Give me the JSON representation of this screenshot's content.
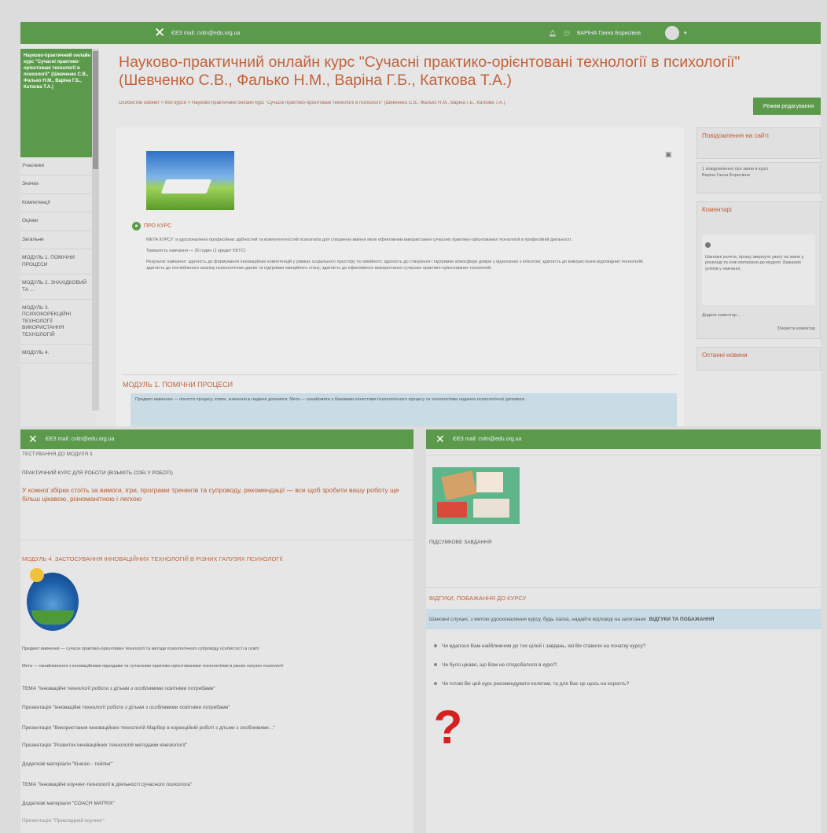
{
  "top": {
    "bar": {
      "email": "ЄЕЗ mail: cvitn@edu.org.ua",
      "user": "ВАРІНА Ганна Борисівна"
    },
    "sidebar": {
      "header": "Науково-практичний онлайн курс \"Сучасні практико-орієнтовані технології в психології\" (Шевченко С.В., Фалько Н.М., Варіна Г.Б., Каткова Т.А.)",
      "items": [
        "Учасники",
        "Значки",
        "Компетенції",
        "Оцінки",
        "Загальне",
        "МОДУЛЬ 1. ПОМІЧНИ ПРОЦЕСИ",
        "МОДУЛЬ 2. ЗНАХІДКОВИЙ ТА ...",
        "МОДУЛЬ 3. ПСИХОКОРЕКЦІЙНІ ТЕХНОЛОГІЇ ВИКОРИСТАННЯ ТЕХНОЛОГІЙ",
        "МОДУЛЬ 4."
      ]
    },
    "title": "Науково-практичний онлайн курс \"Сучасні практико-орієнтовані технології в психології\" (Шевченко С.В., Фалько Н.М., Варіна Г.Б., Каткова Т.А.)",
    "breadcrumb": "Особистий кабінет  >  Мої курси  >  Науково-практичний онлайн курс \"Сучасні практико-орієнтовані технології в психології\" (Шевченко С.В., Фалько Н.М., Варіна Г.Б., Каткова Т.А.)",
    "edit_button": "Режим редагування",
    "about_label": "ПРО КУРС",
    "about_text": [
      "МЕТА КУРСУ: в удосконаленні професійних здібностей та компетентностей психологів для створення вміння якою ефективним використання сучасних практико-орієнтованих технологій в професійній діяльності.",
      "Тривалість навчання — 30 годин (1 кредит ЄКТС)",
      "Результат навчання: здатність до формування інноваційних компетенцій у рамках соціального простору та сімейного; здатність до створення і підтримки атмосфери довіри у відносинах з клієнтом; здатність до використання відповідних технологій; здатність до поглибленого аналізу психологічних даних та підтримки емоційного стану; здатність до ефективного використання сучасних практико-орієнтованих технологій."
    ],
    "module1_title": "МОДУЛЬ 1. ПОМІЧНИ ПРОЦЕСИ",
    "module1_info": "Предмет вивчення — поняття процесу, етапи, значення в наданні допомоги. Мета — ознайомити з базовими поняттями психологічного процесу та технологіями надання психологічної допомоги.",
    "right": {
      "notify_title": "Повідомлення на сайті",
      "notify_text": "1 повідомлення про зміни в курсі",
      "notify_user": "Варіна Ганна Борисівна",
      "comments_title": "Коментарі",
      "comment_text": "Шановні колеги, прошу звернути увагу на зміни у розкладі та нові матеріали до модуля. Бажаємо успіхів у навчанні.",
      "comment_footer": "Додати коментар...",
      "comment_link": "Зберегти коментар",
      "last_title": "Останні новини"
    }
  },
  "bottom_left": {
    "bar": {
      "email": "ЄЕЗ mail: cvitn@edu.org.ua"
    },
    "test_title": "ТЕСТУВАННЯ ДО МОДУЛЯ 3",
    "course_line": "ПРАКТИЧНИЙ КУРС ДЛЯ РОБОТИ (ВІЗЬМІТЬ СОБІ У РОБОТІ)",
    "course_note": "У кожної збірки стоїть за вимоги, ігри, програми тренінгів та супроводу, рекомендації — все щоб зробити вашу роботу ще більш цікавою, різноманітною і легкою",
    "module4_title": "МОДУЛЬ 4. ЗАСТОСУВАННЯ ІННОВАЦІЙНИХ ТЕХНОЛОГІЙ В РІЗНИХ ГАЛУЗЯХ ПСИХОЛОГІЇ",
    "subject": "Предмет вивчення — сучасні практико-орієнтовані технології та методи психологічного супроводу особистості в освіті",
    "goal": "Мета — ознайомлення з інноваційними підходами та сучасними практико-орієнтованими технологіями в різних галузях психології",
    "rows": [
      "ТЕМА \"Інноваційні технології роботи з дітьми з особливими освітніми потребами\"",
      "Презентація \"Інноваційні технології роботи з дітьми з особливими освітніми потребами\"",
      "Презентація \"Використання інноваційних технологій Марбер в корекційній роботі з дітьми з особливими...\"",
      "Презентація \"Розвиток інноваційних технологій методами кінезіології\"",
      "Додаткові матеріали \"Кінезіо - тейпінг\"",
      "ТЕМА \"Інноваційні коучинг-технології в діяльності сучасного психолога\"",
      "Додаткові матеріали \"COACH MATRIX\"",
      "Презентація \"Прикладний коучинг\""
    ]
  },
  "bottom_right": {
    "bar": {
      "email": "ЄЕЗ mail: cvitn@edu.org.ua"
    },
    "final_task": "ПІДСУМКОВЕ ЗАВДАННЯ",
    "wishes_title": "ВІДГУКИ, ПОБАЖАННЯ ДО КУРСУ",
    "wishes_info": "Шановні слухачі, з метою удосконалення курсу, будь ласка, надайте відповіді на запитання",
    "wishes_link": "ВІДГУКИ ТА ПОБАЖАННЯ",
    "questions": [
      "Чи вдалося Вам найближчим до тих цілей і завдань, які Ви ставили на початку курсу?",
      "Чи було цікаво, що Вам не сподобалося в курсі?",
      "Чи готові Ви цей курс рекомендувати колегам, та для Вас це щось на користь?"
    ]
  }
}
